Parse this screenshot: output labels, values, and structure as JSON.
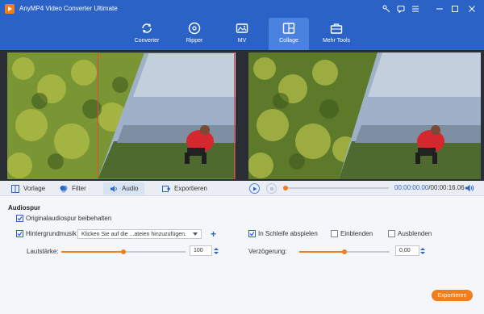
{
  "app": {
    "title": "AnyMP4 Video Converter Ultimate"
  },
  "nav": [
    {
      "label": "Converter",
      "icon": "converter-icon"
    },
    {
      "label": "Ripper",
      "icon": "ripper-icon"
    },
    {
      "label": "MV",
      "icon": "mv-icon"
    },
    {
      "label": "Collage",
      "icon": "collage-icon",
      "active": true
    },
    {
      "label": "Mehr Tools",
      "icon": "toolbox-icon"
    }
  ],
  "tabs": [
    {
      "label": "Vorlage",
      "icon": "template-icon"
    },
    {
      "label": "Filter",
      "icon": "filter-icon"
    },
    {
      "label": "Audio",
      "icon": "audio-icon",
      "active": true
    },
    {
      "label": "Exportieren",
      "icon": "export-icon"
    }
  ],
  "player": {
    "current_time": "00:00:00.00",
    "total_time": "/00:00:16.06",
    "progress": 0.0
  },
  "audio": {
    "section_title": "Audiospur",
    "keep_original_label": "Originalaudiospur beibehalten",
    "keep_original_checked": true,
    "bg_music_label": "Hintergrundmusik",
    "bg_music_checked": true,
    "bg_music_select": "Klicken Sie auf die ...ateien hinzuzufügen.",
    "loop_label": "In Schleife abspielen",
    "loop_checked": true,
    "fade_in_label": "Einblenden",
    "fade_in_checked": false,
    "fade_out_label": "Ausblenden",
    "fade_out_checked": false,
    "volume_label": "Lautstärke:",
    "volume_value": "100",
    "volume_fraction": 0.5,
    "delay_label": "Verzögerung:",
    "delay_value": "0,00",
    "delay_fraction": 0.5
  },
  "export_button": "Exportieren",
  "colors": {
    "brand": "#2a63c5",
    "accent": "#f07e1b"
  }
}
